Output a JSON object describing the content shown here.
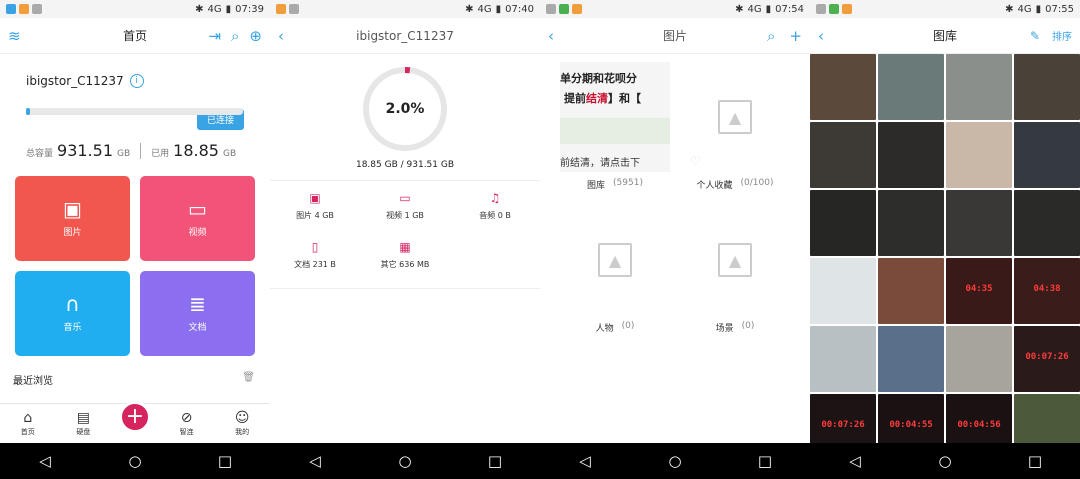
{
  "status_bars": [
    {
      "time": "07:39",
      "net": "4G"
    },
    {
      "time": "07:40",
      "net": "4G"
    },
    {
      "time": "07:54",
      "net": "4G"
    },
    {
      "time": "07:55",
      "net": "4G"
    }
  ],
  "home": {
    "title": "首页",
    "device_name": "ibigstor_C11237",
    "connected_label": "已连接",
    "used_fraction": 0.02,
    "total_label": "总容量",
    "total_value": "931.51",
    "total_unit": "GB",
    "used_label": "已用",
    "used_value": "18.85",
    "used_unit": "GB",
    "tiles": [
      {
        "label": "图片",
        "icon": "image-icon",
        "glyph": "▣",
        "color": "#f2574f"
      },
      {
        "label": "视频",
        "icon": "video-icon",
        "glyph": "▭",
        "color": "#f25479"
      },
      {
        "label": "音乐",
        "icon": "headphones-icon",
        "glyph": "∩",
        "color": "#21aef0"
      },
      {
        "label": "文档",
        "icon": "document-icon",
        "glyph": "≣",
        "color": "#8b6ff0"
      }
    ],
    "recent_label": "最近浏览",
    "tabs": [
      {
        "label": "首页",
        "icon": "home-icon",
        "glyph": "⌂"
      },
      {
        "label": "硬盘",
        "icon": "disk-icon",
        "glyph": "▤"
      },
      {
        "label": "智连",
        "icon": "link-icon",
        "glyph": "⊘"
      },
      {
        "label": "我的",
        "icon": "user-icon",
        "glyph": "☺"
      }
    ]
  },
  "storage": {
    "title": "ibigstor_C11237",
    "percent_text": "2.0%",
    "percent": 0.02,
    "capacity_text": "18.85 GB / 931.51 GB",
    "categories": [
      {
        "label": "图片 4 GB",
        "icon": "image-icon",
        "glyph": "▣"
      },
      {
        "label": "视频 1 GB",
        "icon": "video-icon",
        "glyph": "▭"
      },
      {
        "label": "音频 0 B",
        "icon": "music-icon",
        "glyph": "♫"
      },
      {
        "label": "文档 231 B",
        "icon": "document-icon",
        "glyph": "▯"
      },
      {
        "label": "其它 636 MB",
        "icon": "other-icon",
        "glyph": "▦"
      }
    ]
  },
  "albums": {
    "title": "图片",
    "items": [
      {
        "name": "图库",
        "count": "(5951)"
      },
      {
        "name": "个人收藏",
        "count": "(0/100)"
      },
      {
        "name": "人物",
        "count": "(0)"
      },
      {
        "name": "场景",
        "count": "(0)"
      }
    ],
    "cover_text": {
      "line1": "单分期和花呗分",
      "line2a": "提前",
      "line2b": "结清",
      "line2c": "】和【",
      "line3": "前结清，请点击下"
    }
  },
  "gallery": {
    "title": "图库",
    "sort_label": "排序",
    "photos": [
      {
        "color": "#5b4a3c"
      },
      {
        "color": "#6a7a78"
      },
      {
        "color": "#8a8f8c"
      },
      {
        "color": "#4a4238"
      },
      {
        "color": "#3d3a35"
      },
      {
        "color": "#2c2b29"
      },
      {
        "color": "#c9b8a8"
      },
      {
        "color": "#353a40"
      },
      {
        "color": "#262624"
      },
      {
        "color": "#2d2d2b"
      },
      {
        "color": "#3a3836"
      },
      {
        "color": "#2a2a28"
      },
      {
        "color": "#dfe4e6",
        "led": ""
      },
      {
        "color": "#7a4a3a"
      },
      {
        "color": "#3a1a18",
        "led": "04:35"
      },
      {
        "color": "#3a1c1a",
        "led": "04:38"
      },
      {
        "color": "#b8c0c4"
      },
      {
        "color": "#5a6f8a"
      },
      {
        "color": "#a7a49c"
      },
      {
        "color": "#2a1a1a",
        "led": "00:07:26"
      },
      {
        "color": "#1c1414",
        "led": "00:07:26"
      },
      {
        "color": "#1a1212",
        "led": "00:04:55"
      },
      {
        "color": "#1a1212",
        "led": "00:04:56"
      },
      {
        "color": "#4a5a3a"
      }
    ]
  }
}
